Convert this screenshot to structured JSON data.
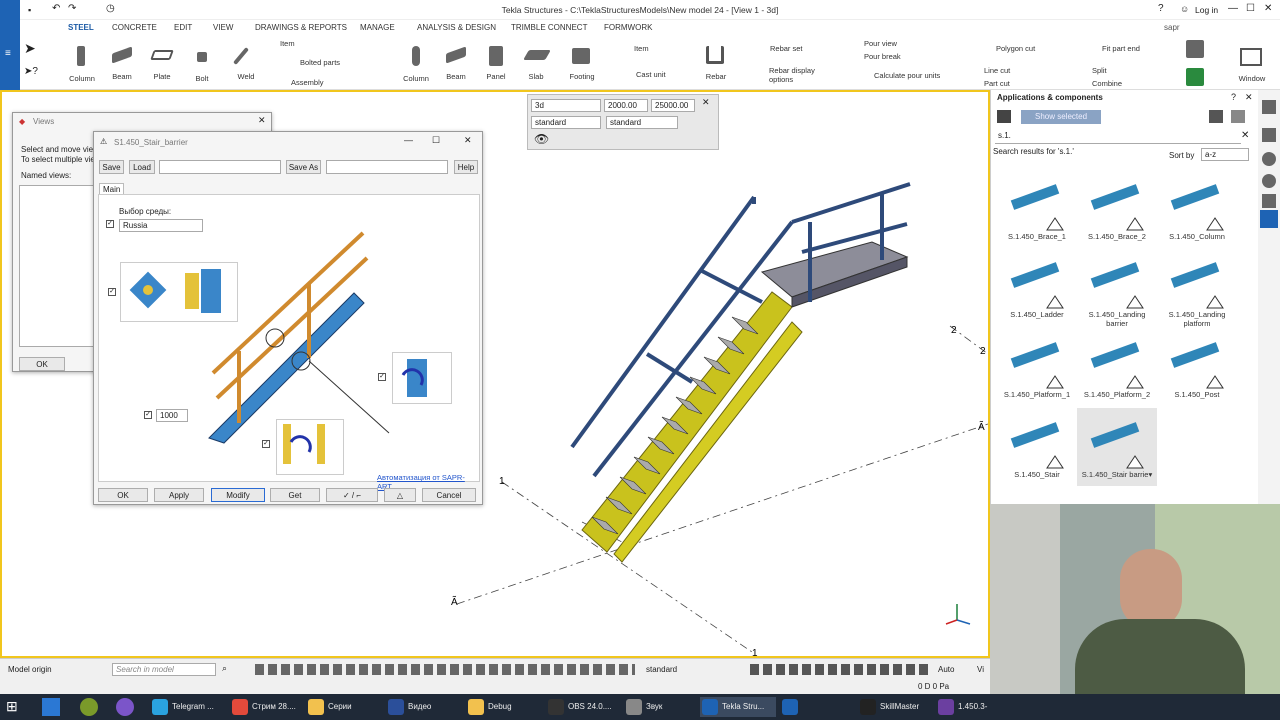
{
  "app": {
    "title": "Tekla Structures - C:\\TeklaStructuresModels\\New model 24 - [View 1 - 3d]",
    "login": "Log in",
    "user": "sapr"
  },
  "ribbon": {
    "tabs": [
      "STEEL",
      "CONCRETE",
      "EDIT",
      "VIEW",
      "DRAWINGS & REPORTS",
      "MANAGE",
      "ANALYSIS & DESIGN",
      "TRIMBLE CONNECT",
      "FORMWORK"
    ],
    "active_tab": "STEEL"
  },
  "toolbar": {
    "column": "Column",
    "beam": "Beam",
    "plate": "Plate",
    "bolt": "Bolt",
    "weld": "Weld",
    "item": "Item",
    "bolted_parts": "Bolted parts",
    "assembly": "Assembly",
    "c_column": "Column",
    "c_beam": "Beam",
    "panel": "Panel",
    "slab": "Slab",
    "footing": "Footing",
    "c_item": "Item",
    "cast_unit": "Cast unit",
    "rebar": "Rebar",
    "rebar_set": "Rebar set",
    "rebar_display": "Rebar display options",
    "pour_view": "Pour view",
    "pour_break": "Pour break",
    "calc_pour": "Calculate pour units",
    "polygon_cut": "Polygon cut",
    "line_cut": "Line cut",
    "part_cut": "Part cut",
    "fit_part_end": "Fit part end",
    "split": "Split",
    "combine": "Combine",
    "window": "Window"
  },
  "view_ctrl": {
    "view": "3d",
    "v1": "2000.00",
    "v2": "25000.00",
    "rep1": "standard",
    "rep2": "standard"
  },
  "views_dialog": {
    "title": "Views",
    "text1": "Select and move view",
    "text2": "To select multiple vie",
    "named": "Named views:",
    "ok": "OK"
  },
  "barrier_dialog": {
    "title": "S1.450_Stair_barrier",
    "save": "Save",
    "load": "Load",
    "save_as": "Save As",
    "help": "Help",
    "tab": "Main",
    "env_label": "Выбор среды:",
    "env_value": "Russia",
    "dim": "1000",
    "link": "Автоматизация от SAPR-ART",
    "ok": "OK",
    "apply": "Apply",
    "modify": "Modify",
    "get": "Get",
    "toggle": "✓ / ⌐",
    "cancel": "Cancel"
  },
  "apps": {
    "title": "Applications & components",
    "show_selected": "Show selected",
    "search": "s.1.",
    "results": "Search results for 's.1.'",
    "sort_by": "Sort by",
    "sort": "a-z",
    "items": [
      {
        "label": "S.1.450_Brace_1"
      },
      {
        "label": "S.1.450_Brace_2"
      },
      {
        "label": "S.1.450_Column"
      },
      {
        "label": "S.1.450_Ladder"
      },
      {
        "label": "S.1.450_Landing barrier"
      },
      {
        "label": "S.1.450_Landing platform"
      },
      {
        "label": "S.1.450_Platform_1"
      },
      {
        "label": "S.1.450_Platform_2"
      },
      {
        "label": "S.1.450_Post"
      },
      {
        "label": "S.1.450_Stair"
      },
      {
        "label": "S.1.450_Stair barrie▾"
      }
    ]
  },
  "grid": {
    "a1": "Ã",
    "a2": "Ã",
    "n1": "1",
    "n2": "2",
    "n3": "2",
    "n4": "1"
  },
  "status": {
    "model_origin": "Model origin",
    "search": "Search in model",
    "standard": "standard",
    "auto": "Auto",
    "v": "Vi",
    "nums": "0    D    0    Pa"
  },
  "taskbar": [
    {
      "label": "Telegram ...",
      "color": "#2aa3e0"
    },
    {
      "label": "Стрим 28....",
      "color": "#e24a3b"
    },
    {
      "label": "Серии",
      "color": "#f2c14e"
    },
    {
      "label": "Видео",
      "color": "#2b4f9a"
    },
    {
      "label": "Debug",
      "color": "#f2c14e"
    },
    {
      "label": "OBS 24.0....",
      "color": "#333"
    },
    {
      "label": "Звук",
      "color": "#888"
    },
    {
      "label": "Tekla Stru...",
      "color": "#1e63b4"
    },
    {
      "label": "",
      "color": "#1e63b4"
    },
    {
      "label": "SkillMaster",
      "color": "#222"
    },
    {
      "label": "1.450.3-",
      "color": "#6b3fa0"
    }
  ]
}
